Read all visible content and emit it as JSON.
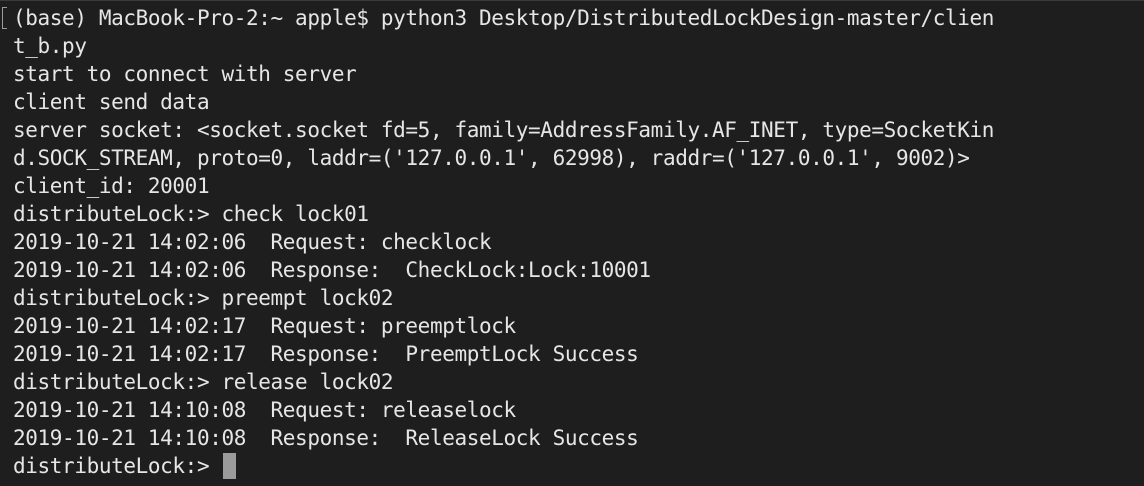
{
  "terminal": {
    "lines": [
      "(base) MacBook-Pro-2:~ apple$ python3 Desktop/DistributedLockDesign-master/clien",
      "t_b.py",
      "start to connect with server",
      "client send data",
      "server socket: <socket.socket fd=5, family=AddressFamily.AF_INET, type=SocketKin",
      "d.SOCK_STREAM, proto=0, laddr=('127.0.0.1', 62998), raddr=('127.0.0.1', 9002)>",
      "client_id: 20001",
      "distributeLock:> check lock01",
      "2019-10-21 14:02:06  Request: checklock",
      "2019-10-21 14:02:06  Response:  CheckLock:Lock:10001",
      "distributeLock:> preempt lock02",
      "2019-10-21 14:02:17  Request: preemptlock",
      "2019-10-21 14:02:17  Response:  PreemptLock Success",
      "distributeLock:> release lock02",
      "2019-10-21 14:10:08  Request: releaselock",
      "2019-10-21 14:10:08  Response:  ReleaseLock Success"
    ],
    "prompt": "distributeLock:> "
  }
}
